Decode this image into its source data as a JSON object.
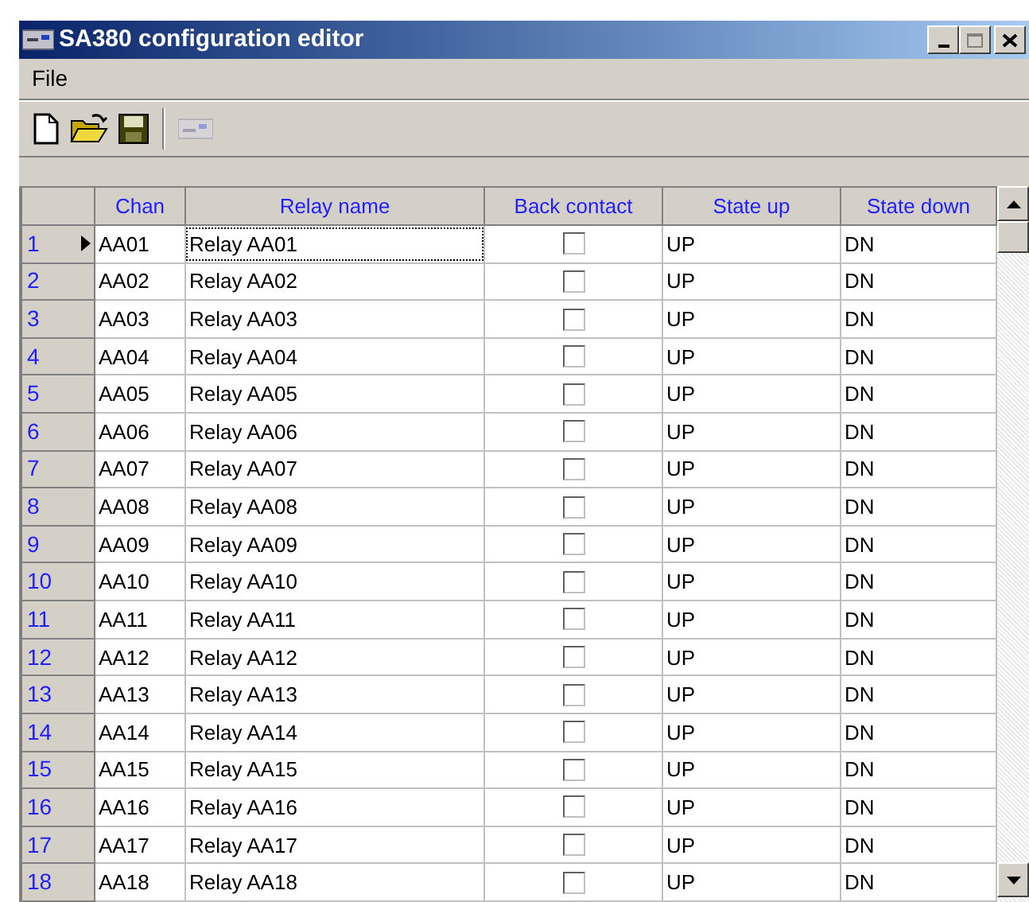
{
  "window": {
    "title": "SA380 configuration editor"
  },
  "menu": [
    "File"
  ],
  "toolbar": [
    {
      "kind": "new"
    },
    {
      "kind": "open"
    },
    {
      "kind": "save"
    },
    {
      "kind": "separator"
    },
    {
      "kind": "device",
      "disabled": true
    }
  ],
  "table": {
    "columns": [
      "Chan",
      "Relay name",
      "Back contact",
      "State up",
      "State down"
    ],
    "rows": [
      {
        "number": "1",
        "chan": "AA01",
        "relay_name": "Relay AA01",
        "back_contact": false,
        "state_up": "UP",
        "state_down": "DN",
        "selected": true
      },
      {
        "number": "2",
        "chan": "AA02",
        "relay_name": "Relay AA02",
        "back_contact": false,
        "state_up": "UP",
        "state_down": "DN",
        "selected": false
      },
      {
        "number": "3",
        "chan": "AA03",
        "relay_name": "Relay AA03",
        "back_contact": false,
        "state_up": "UP",
        "state_down": "DN",
        "selected": false
      },
      {
        "number": "4",
        "chan": "AA04",
        "relay_name": "Relay AA04",
        "back_contact": false,
        "state_up": "UP",
        "state_down": "DN",
        "selected": false
      },
      {
        "number": "5",
        "chan": "AA05",
        "relay_name": "Relay AA05",
        "back_contact": false,
        "state_up": "UP",
        "state_down": "DN",
        "selected": false
      },
      {
        "number": "6",
        "chan": "AA06",
        "relay_name": "Relay AA06",
        "back_contact": false,
        "state_up": "UP",
        "state_down": "DN",
        "selected": false
      },
      {
        "number": "7",
        "chan": "AA07",
        "relay_name": "Relay AA07",
        "back_contact": false,
        "state_up": "UP",
        "state_down": "DN",
        "selected": false
      },
      {
        "number": "8",
        "chan": "AA08",
        "relay_name": "Relay AA08",
        "back_contact": false,
        "state_up": "UP",
        "state_down": "DN",
        "selected": false
      },
      {
        "number": "9",
        "chan": "AA09",
        "relay_name": "Relay AA09",
        "back_contact": false,
        "state_up": "UP",
        "state_down": "DN",
        "selected": false
      },
      {
        "number": "10",
        "chan": "AA10",
        "relay_name": "Relay AA10",
        "back_contact": false,
        "state_up": "UP",
        "state_down": "DN",
        "selected": false
      },
      {
        "number": "11",
        "chan": "AA11",
        "relay_name": "Relay AA11",
        "back_contact": false,
        "state_up": "UP",
        "state_down": "DN",
        "selected": false
      },
      {
        "number": "12",
        "chan": "AA12",
        "relay_name": "Relay AA12",
        "back_contact": false,
        "state_up": "UP",
        "state_down": "DN",
        "selected": false
      },
      {
        "number": "13",
        "chan": "AA13",
        "relay_name": "Relay AA13",
        "back_contact": false,
        "state_up": "UP",
        "state_down": "DN",
        "selected": false
      },
      {
        "number": "14",
        "chan": "AA14",
        "relay_name": "Relay AA14",
        "back_contact": false,
        "state_up": "UP",
        "state_down": "DN",
        "selected": false
      },
      {
        "number": "15",
        "chan": "AA15",
        "relay_name": "Relay AA15",
        "back_contact": false,
        "state_up": "UP",
        "state_down": "DN",
        "selected": false
      },
      {
        "number": "16",
        "chan": "AA16",
        "relay_name": "Relay AA16",
        "back_contact": false,
        "state_up": "UP",
        "state_down": "DN",
        "selected": false
      },
      {
        "number": "17",
        "chan": "AA17",
        "relay_name": "Relay AA17",
        "back_contact": false,
        "state_up": "UP",
        "state_down": "DN",
        "selected": false
      },
      {
        "number": "18",
        "chan": "AA18",
        "relay_name": "Relay AA18",
        "back_contact": false,
        "state_up": "UP",
        "state_down": "DN",
        "selected": false
      }
    ]
  }
}
